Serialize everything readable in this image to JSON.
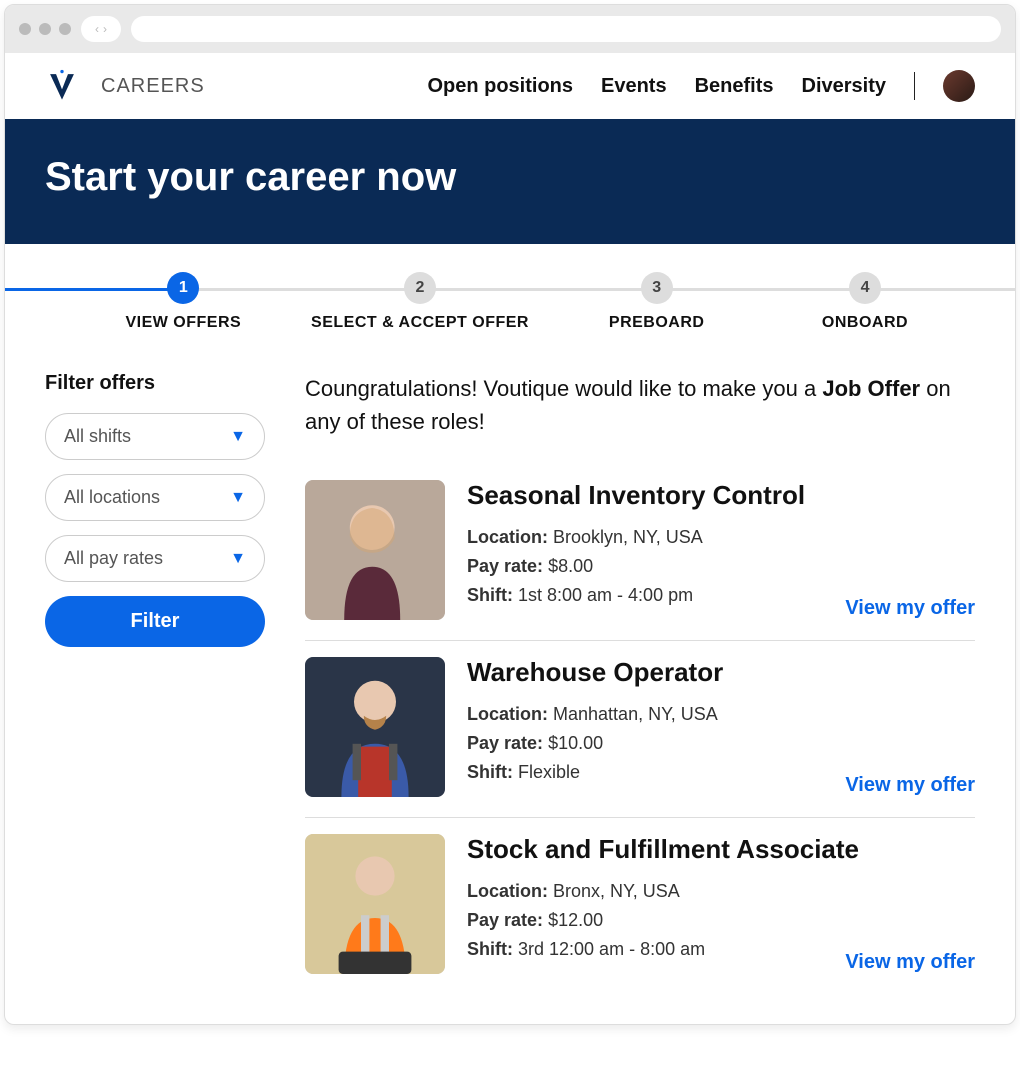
{
  "header": {
    "brand": "CAREERS",
    "nav": {
      "open_positions": "Open positions",
      "events": "Events",
      "benefits": "Benefits",
      "diversity": "Diversity"
    }
  },
  "hero": {
    "title": "Start your career now"
  },
  "stepper": {
    "steps": [
      {
        "num": "1",
        "label": "VIEW OFFERS",
        "active": true
      },
      {
        "num": "2",
        "label": "SELECT & ACCEPT OFFER",
        "active": false
      },
      {
        "num": "3",
        "label": "PREBOARD",
        "active": false
      },
      {
        "num": "4",
        "label": "ONBOARD",
        "active": false
      }
    ]
  },
  "sidebar": {
    "title": "Filter offers",
    "shifts": "All shifts",
    "locations": "All locations",
    "pay_rates": "All pay rates",
    "filter_btn": "Filter"
  },
  "main": {
    "intro_prefix": "Coungratulations! Voutique would like to make you a ",
    "intro_bold": "Job Offer",
    "intro_suffix": " on any of these roles!",
    "labels": {
      "location": "Location:",
      "pay_rate": "Pay rate:",
      "shift": "Shift:",
      "view_link": "View my offer"
    },
    "offers": [
      {
        "title": "Seasonal Inventory Control",
        "location": "Brooklyn, NY, USA",
        "pay_rate": "$8.00",
        "shift": "1st 8:00 am - 4:00 pm"
      },
      {
        "title": "Warehouse Operator",
        "location": "Manhattan, NY, USA",
        "pay_rate": "$10.00",
        "shift": "Flexible"
      },
      {
        "title": "Stock and Fulfillment Associate",
        "location": "Bronx, NY, USA",
        "pay_rate": "$12.00",
        "shift": "3rd 12:00 am - 8:00 am"
      }
    ]
  }
}
